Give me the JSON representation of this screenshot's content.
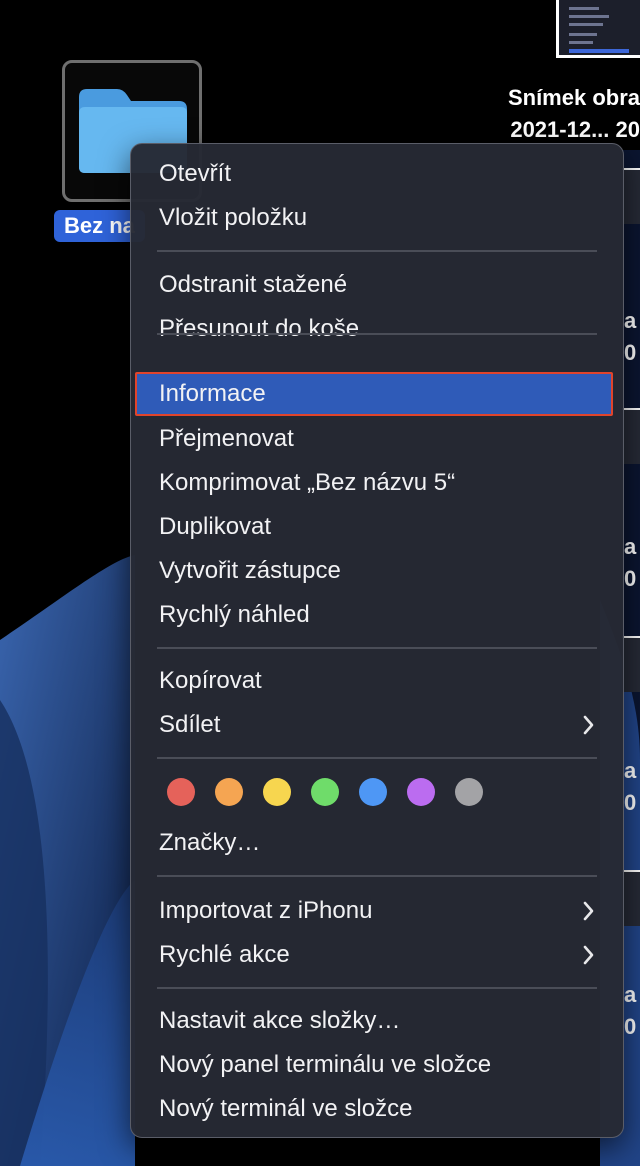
{
  "desktop": {
    "folder": {
      "label": "Bez na",
      "color": "#5aaeea"
    },
    "screenshot_file": {
      "label_line1": "Snímek obra",
      "label_line2": "2021-12... 20"
    },
    "side_files": [
      {
        "label_line1": "a",
        "label_line2": "0"
      },
      {
        "label_line1": "a",
        "label_line2": "0"
      },
      {
        "label_line1": "a",
        "label_line2": "0"
      },
      {
        "label_line1": "a",
        "label_line2": "0"
      }
    ]
  },
  "context_menu": {
    "group1": [
      {
        "label": "Otevřít"
      },
      {
        "label": "Vložit položku"
      }
    ],
    "group2": [
      {
        "label": "Odstranit stažené"
      },
      {
        "label": "Přesunout do koše"
      }
    ],
    "group3": [
      {
        "label": "Informace",
        "highlighted": true
      },
      {
        "label": "Přejmenovat"
      },
      {
        "label": "Komprimovat „Bez názvu 5“"
      },
      {
        "label": "Duplikovat"
      },
      {
        "label": "Vytvořit zástupce"
      },
      {
        "label": "Rychlý náhled"
      }
    ],
    "group4": [
      {
        "label": "Kopírovat"
      },
      {
        "label": "Sdílet",
        "submenu": true
      }
    ],
    "tags": {
      "colors": [
        "#e5625a",
        "#f5a552",
        "#f7d64f",
        "#6fdc6a",
        "#4e97f5",
        "#bb6cf0",
        "#a3a3a6"
      ],
      "label": "Značky…"
    },
    "group6": [
      {
        "label": "Importovat z iPhonu",
        "submenu": true
      },
      {
        "label": "Rychlé akce",
        "submenu": true
      }
    ],
    "group7": [
      {
        "label": "Nastavit akce složky…"
      },
      {
        "label": "Nový panel terminálu ve složce"
      },
      {
        "label": "Nový terminál ve složce"
      }
    ],
    "colors": {
      "highlight": "#2f5bb8",
      "highlight_outline": "#e0442c"
    }
  }
}
